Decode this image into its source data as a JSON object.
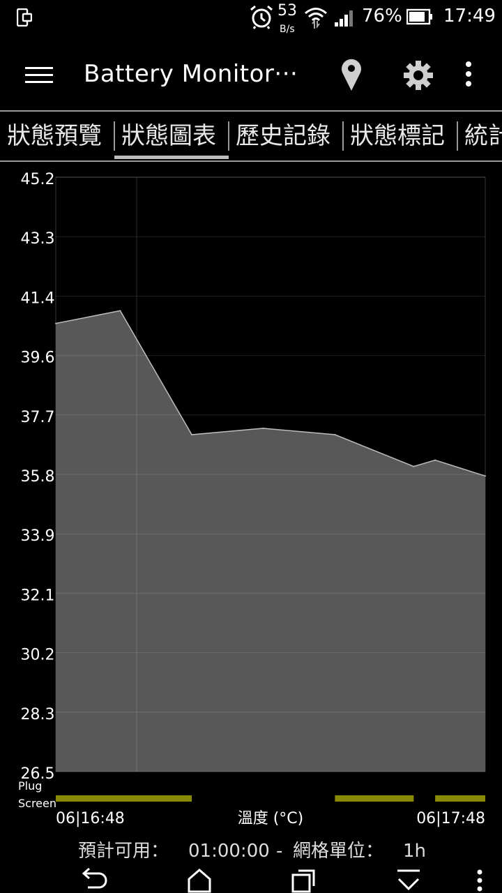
{
  "status_bar": {
    "speed": "53",
    "speed_unit": "B/s",
    "battery_percent": "76%",
    "time": "17:49"
  },
  "app_bar": {
    "title": "Battery Monitor···"
  },
  "tabs": [
    {
      "label": "狀態預覽",
      "selected": false
    },
    {
      "label": "狀態圖表",
      "selected": true
    },
    {
      "label": "歷史記錄",
      "selected": false
    },
    {
      "label": "狀態標記",
      "selected": false
    },
    {
      "label": "統計",
      "selected": false
    }
  ],
  "chart_data": {
    "type": "area",
    "title": "溫度 (°C)",
    "ylabel": "",
    "xlabel": "溫度 (°C)",
    "x_start_label": "06|16:48",
    "x_end_label": "06|17:48",
    "y_ticks": [
      "45.2",
      "43.3",
      "41.4",
      "39.6",
      "37.7",
      "35.8",
      "33.9",
      "32.1",
      "30.2",
      "28.3",
      "26.5"
    ],
    "ylim": [
      26.5,
      45.2
    ],
    "xlim_minutes": [
      0,
      60
    ],
    "x_minutes": [
      0,
      9,
      19,
      29,
      39,
      50,
      53,
      60
    ],
    "values": [
      40.6,
      41.0,
      37.1,
      37.3,
      37.1,
      36.1,
      36.3,
      35.8
    ],
    "vertical_marker_minute": 11.3,
    "grid": true,
    "fill_color": "#585858",
    "line_color": "#bdbdbd",
    "bar_color": "#8a8a00",
    "row_labels": [
      "Plug",
      "Screen"
    ],
    "screen_on_segments_minutes": [
      [
        0,
        19
      ],
      [
        39,
        50
      ],
      [
        53,
        60
      ]
    ]
  },
  "footer": {
    "estimate_label": "預計可用：",
    "estimate_value": "01:00:00",
    "separator": "-",
    "grid_unit_label": "網格單位：",
    "grid_unit_value": "1h"
  },
  "icons": {
    "status": [
      "phone-icon",
      "alarm-icon",
      "wifi-icon",
      "signal-icon",
      "battery-icon"
    ],
    "app_bar": [
      "menu-icon",
      "location-icon",
      "gear-icon",
      "more-icon"
    ],
    "nav_bar": [
      "back-icon",
      "home-icon",
      "recents-icon",
      "notifications-icon",
      "more-icon"
    ]
  }
}
